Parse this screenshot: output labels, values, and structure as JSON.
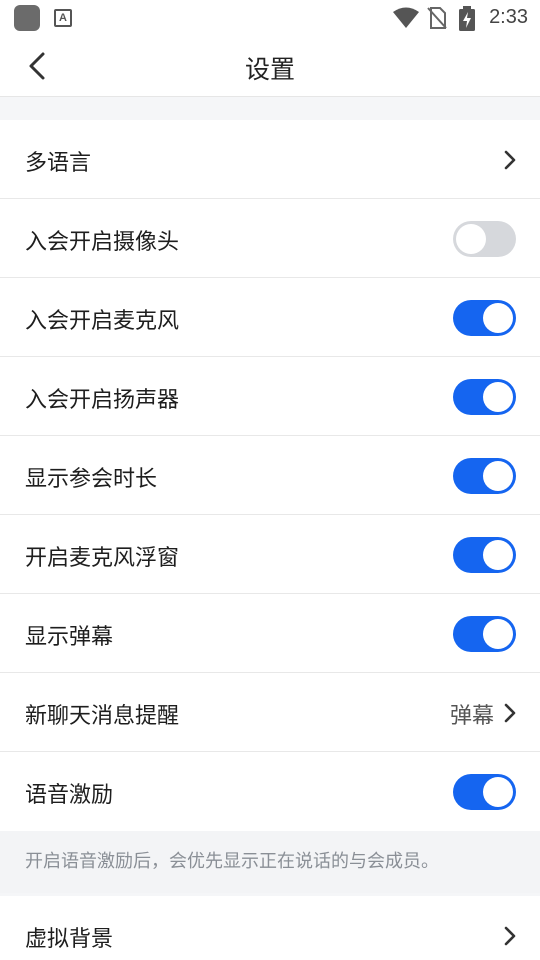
{
  "status_bar": {
    "time": "2:33",
    "icons": [
      "app-icon",
      "keyboard-a-icon",
      "wifi-icon",
      "no-sim-icon",
      "battery-charging-icon"
    ],
    "a_glyph": "A"
  },
  "nav": {
    "title": "设置",
    "back_icon": "chevron-left-icon"
  },
  "settings": [
    {
      "label": "多语言",
      "type": "link"
    },
    {
      "label": "入会开启摄像头",
      "type": "toggle",
      "on": false
    },
    {
      "label": "入会开启麦克风",
      "type": "toggle",
      "on": true
    },
    {
      "label": "入会开启扬声器",
      "type": "toggle",
      "on": true
    },
    {
      "label": "显示参会时长",
      "type": "toggle",
      "on": true
    },
    {
      "label": "开启麦克风浮窗",
      "type": "toggle",
      "on": true
    },
    {
      "label": "显示弹幕",
      "type": "toggle",
      "on": true
    },
    {
      "label": "新聊天消息提醒",
      "type": "link",
      "value": "弹幕"
    },
    {
      "label": "语音激励",
      "type": "toggle",
      "on": true
    },
    {
      "label": "虚拟背景",
      "type": "link"
    }
  ],
  "hint_text": "开启语音激励后，会优先显示正在说话的与会成员。",
  "colors": {
    "accent": "#1565f0",
    "toggle_off": "#d6d8dc",
    "background": "#f5f6f8"
  }
}
